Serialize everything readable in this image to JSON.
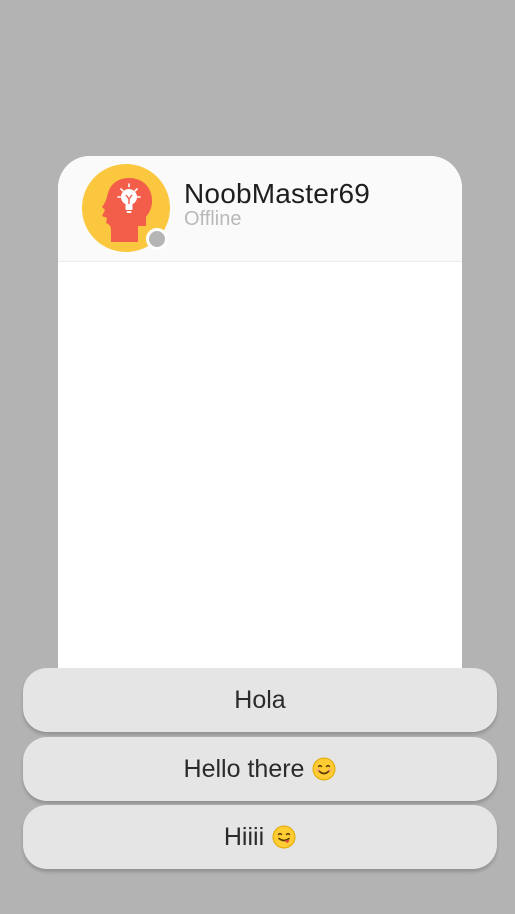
{
  "contact": {
    "name": "NoobMaster69",
    "status": "Offline",
    "avatar_icon": "head-lightbulb-icon",
    "avatar_bg_color": "#fbc73e",
    "avatar_fg_color": "#f25e4a",
    "status_dot_color": "#b5b5b5"
  },
  "quick_replies": [
    {
      "label": "Hola",
      "emoji_icon": null
    },
    {
      "label": "Hello there",
      "emoji_icon": "smiling-face-icon"
    },
    {
      "label": "Hiiii",
      "emoji_icon": "face-savoring-food-icon"
    }
  ],
  "colors": {
    "background": "#b3b3b3",
    "card": "#ffffff",
    "header": "#fafafa",
    "reply_button": "#e5e5e5"
  }
}
